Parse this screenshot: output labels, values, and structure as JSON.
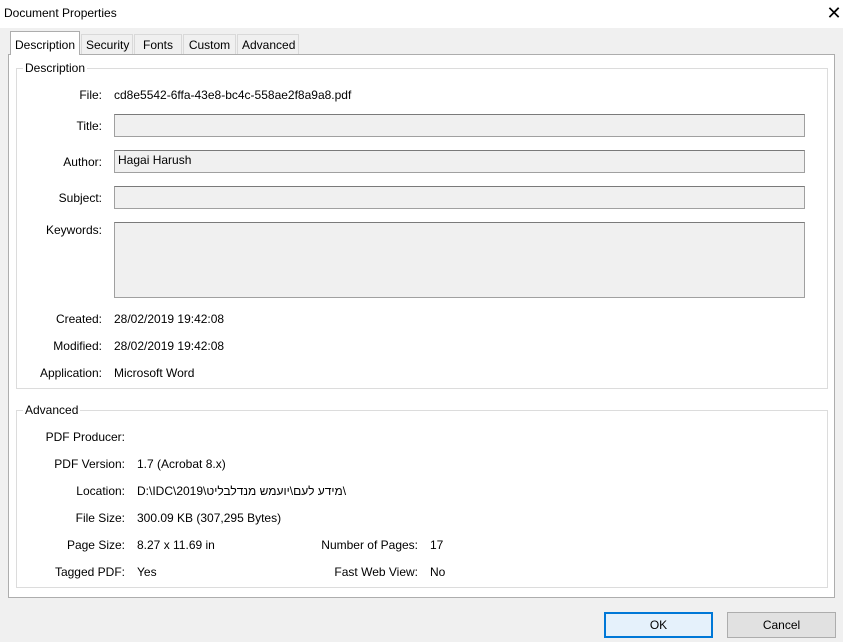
{
  "window": {
    "title": "Document Properties",
    "close_glyph": "✕"
  },
  "tabs": [
    {
      "label": "Description",
      "active": true
    },
    {
      "label": "Security",
      "active": false
    },
    {
      "label": "Fonts",
      "active": false
    },
    {
      "label": "Custom",
      "active": false
    },
    {
      "label": "Advanced",
      "active": false
    }
  ],
  "description": {
    "legend": "Description",
    "file_label": "File:",
    "file_value": "cd8e5542-6ffa-43e8-bc4c-558ae2f8a9a8.pdf",
    "title_label": "Title:",
    "title_value": "",
    "author_label": "Author:",
    "author_value": "Hagai Harush",
    "subject_label": "Subject:",
    "subject_value": "",
    "keywords_label": "Keywords:",
    "keywords_value": "",
    "created_label": "Created:",
    "created_value": "28/02/2019 19:42:08",
    "modified_label": "Modified:",
    "modified_value": "28/02/2019 19:42:08",
    "application_label": "Application:",
    "application_value": "Microsoft Word"
  },
  "advanced": {
    "legend": "Advanced",
    "producer_label": "PDF Producer:",
    "producer_value": "",
    "version_label": "PDF Version:",
    "version_value": "1.7 (Acrobat 8.x)",
    "location_label": "Location:",
    "location_value": "D:\\IDC\\2019\\מידע לעם\\יועמש מנדלבליט\\",
    "filesize_label": "File Size:",
    "filesize_value": "300.09 KB (307,295 Bytes)",
    "pagesize_label": "Page Size:",
    "pagesize_value": "8.27 x 11.69 in",
    "numpages_label": "Number of Pages:",
    "numpages_value": "17",
    "tagged_label": "Tagged PDF:",
    "tagged_value": "Yes",
    "fastweb_label": "Fast Web View:",
    "fastweb_value": "No"
  },
  "buttons": {
    "ok": "OK",
    "cancel": "Cancel"
  },
  "colors": {
    "accent": "#0078d7",
    "field_bg": "#f0f0f0"
  }
}
